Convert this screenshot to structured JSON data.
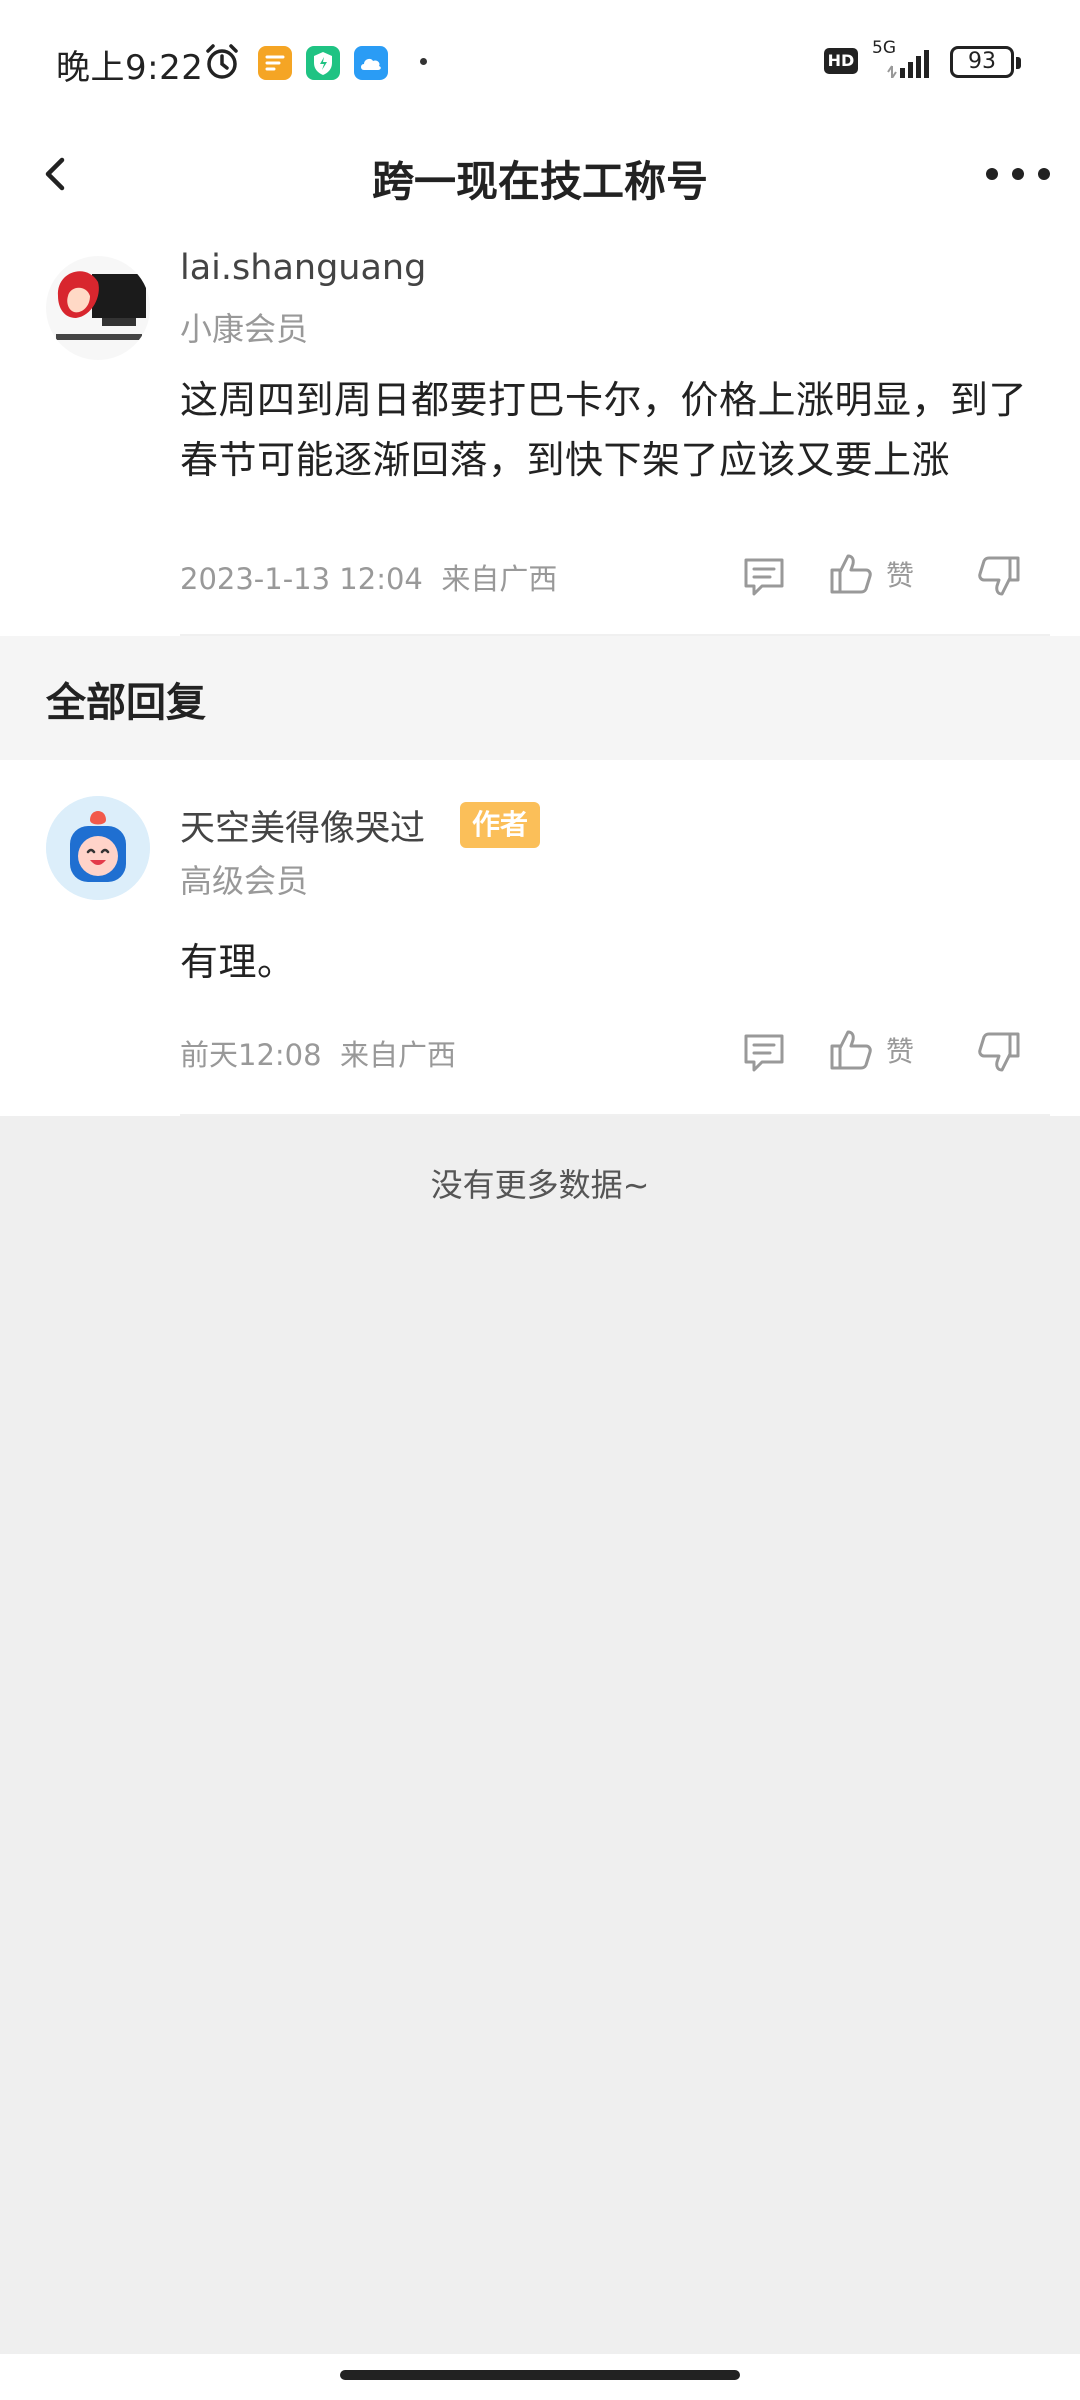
{
  "status_bar": {
    "time": "晚上9:22",
    "network": "5G",
    "hd": "HD",
    "battery": "93",
    "app_icons": [
      "alarm-icon",
      "notes-app-icon",
      "security-app-icon",
      "cloud-app-icon"
    ]
  },
  "nav": {
    "title": "跨一现在技工称号"
  },
  "post": {
    "username": "lai.shanguang",
    "member_level": "小康会员",
    "content": "这周四到周日都要打巴卡尔，价格上涨明显，到了春节可能逐渐回落，到快下架了应该又要上涨",
    "timestamp": "2023-1-13 12:04",
    "location": "来自广西",
    "like_label": "赞"
  },
  "section": {
    "title": "全部回复"
  },
  "reply": {
    "username": "天空美得像哭过",
    "badge": "作者",
    "member_level": "高级会员",
    "content": "有理。",
    "timestamp": "前天12:08",
    "location": "来自广西",
    "like_label": "赞"
  },
  "footer": {
    "no_more": "没有更多数据~"
  },
  "colors": {
    "badge": "#fbbf59",
    "muted_text": "#999999",
    "page_bg": "#efefef"
  }
}
